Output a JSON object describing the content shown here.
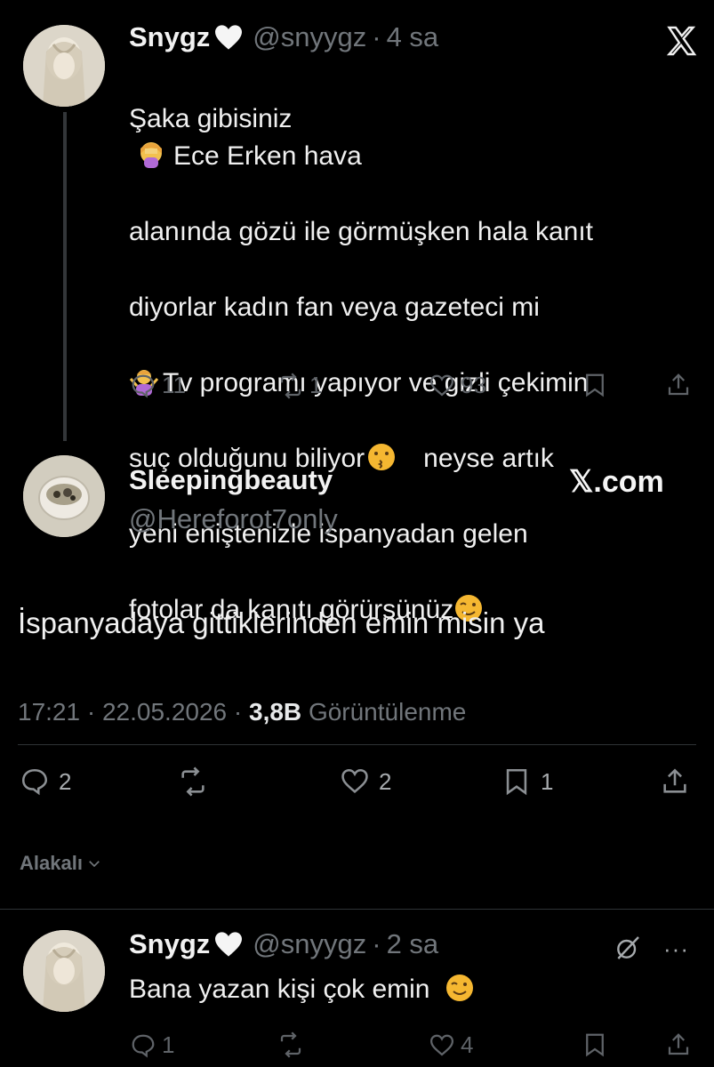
{
  "tweet1": {
    "name": "Snygz",
    "handle": "@snyygz",
    "time": "4 sa",
    "lines": [
      "Şaka gibisiniz",
      "Ece Erken hava",
      "alanında gözü ile görmüşken hala kanıt",
      "diyorlar kadın fan veya gazeteci mi",
      "Tv programı yapıyor ve gizli çekimin",
      "suç olduğunu biliyor",
      "neyse artık",
      "yeni eniştenizle ispanyadan gelen",
      "fotolar da kanıtı görürsünüz"
    ],
    "replies": "11",
    "reposts": "1",
    "likes": "93",
    "icons": {
      "close": "x-logo-icon",
      "heart": "heart-icon"
    }
  },
  "tweet2": {
    "name": "Sleepingbeauty",
    "handle": "@Hereforot7only",
    "watermark": "𝕏.com",
    "text": "İspanyadaya gittiklerinden emin misin ya",
    "time": "17:21",
    "date": "22.05.2026",
    "views": "3,8B",
    "views_label": "Görüntülenme",
    "replies": "2",
    "likes": "2",
    "bookmarks": "1"
  },
  "relevance": {
    "label": "Alakalı"
  },
  "tweet3": {
    "name": "Snygz",
    "handle": "@snyygz",
    "time": "2 sa",
    "text": "Bana yazan kişi çok emin",
    "replies": "1",
    "likes": "4"
  },
  "colors": {
    "background": "#000000",
    "muted": "#71767b",
    "text": "#e7e9ea"
  }
}
